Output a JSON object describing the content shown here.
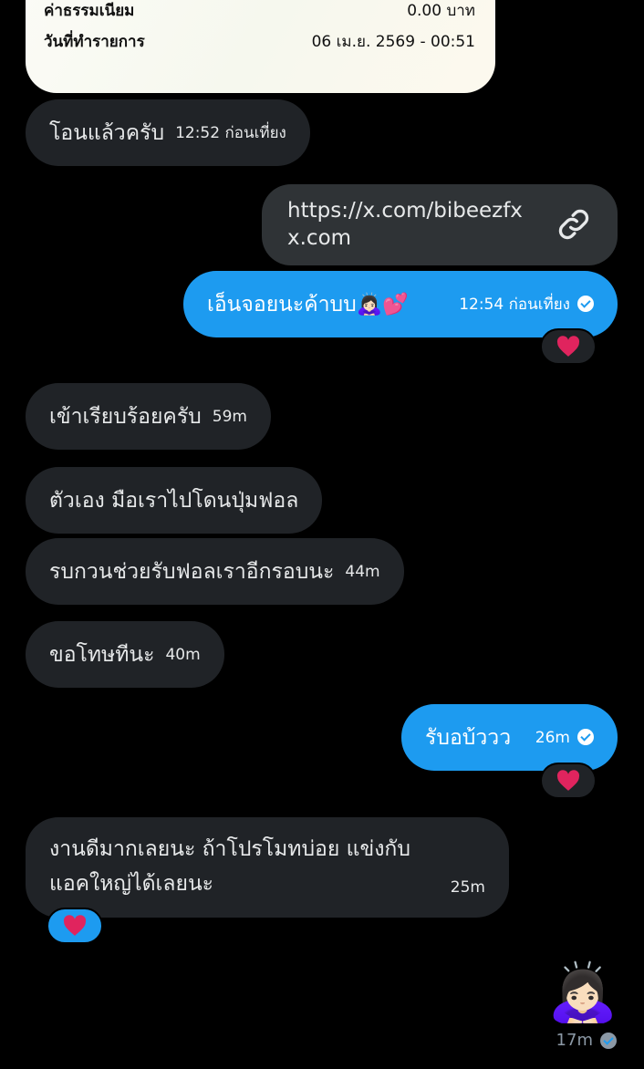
{
  "receipt": {
    "fee_label": "ค่าธรรมเนียม",
    "fee_value": "0.00 บาท",
    "date_label": "วันที่ทำรายการ",
    "date_value": "06 เม.ย. 2569 - 00:51"
  },
  "messages": [
    {
      "text": "โอนแล้วครับ",
      "time": "12:52 ก่อนเที่ยง"
    },
    {
      "link_url": "https://x.com/bibeezfx",
      "link_domain": "x.com",
      "link_icon": "link-icon"
    },
    {
      "text": "เอ็นจอยนะค้าบบ🙇🏻‍♀️💕",
      "time": "12:54 ก่อนเที่ยง",
      "reaction": "❤️"
    },
    {
      "text": "เข้าเรียบร้อยครับ",
      "time": "59m"
    },
    {
      "text": "ตัวเอง มือเราไปโดนปุ่มฟอล"
    },
    {
      "text": "รบกวนช่วยรับฟอลเราอีกรอบนะ",
      "time": "44m"
    },
    {
      "text": "ขอโทษทีนะ",
      "time": "40m"
    },
    {
      "text": "รับอบ้ววว",
      "time": "26m",
      "reaction": "❤️"
    },
    {
      "text_line1": "งานดีมากเลยนะ ถ้าโปรโมทบ่อย แข่งกับ",
      "text_line2": "แอคใหญ่ได้เลยนะ",
      "time": "25m",
      "reaction": "❤️"
    },
    {
      "emoji": "🙇🏻‍♀️",
      "time": "17m"
    }
  ],
  "colors": {
    "background": "#000000",
    "incoming_bubble": "#202327",
    "outgoing_bubble": "#1d9bf0",
    "link_card": "#2f3336",
    "heart": "#e0245e"
  }
}
